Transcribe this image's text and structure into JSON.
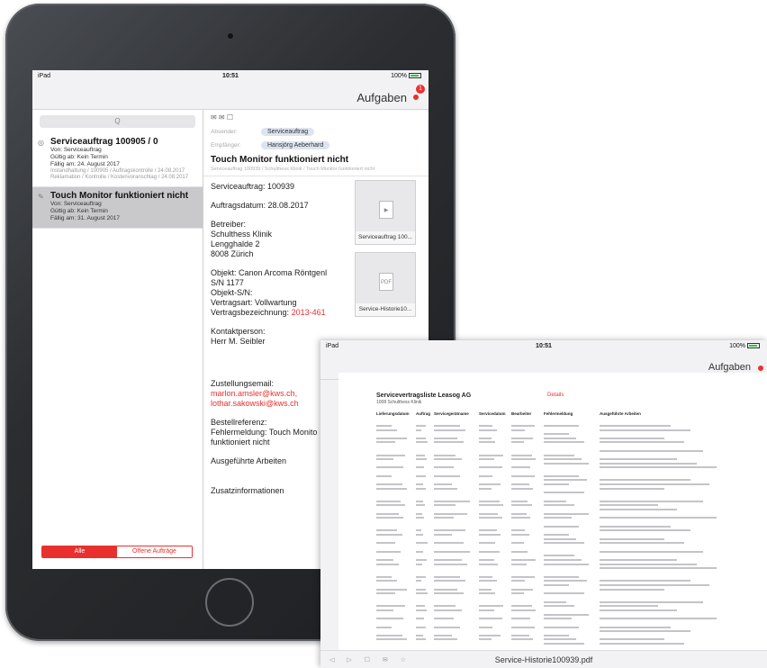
{
  "device": {
    "status": {
      "carrier": "iPad",
      "time": "10:51",
      "battery": "100%"
    },
    "nav_title": "Aufgaben",
    "badge": "1",
    "search_placeholder": "Q",
    "tasks": [
      {
        "title": "Serviceauftrag 100905 / 0",
        "from": "Von: Serviceauftrag",
        "valid": "Gültig ab: Kein Termin",
        "due": "Fällig am: 24. August 2017",
        "faint1": "Instandhaltung / 100905 / Auftragskontrolle / 24.08.2017",
        "faint2": "Reklamation / Kontrolle / Kostenvoranschlag / 24.08.2017"
      },
      {
        "title": "Touch Monitor funktioniert nicht",
        "from": "Von: Serviceauftrag",
        "valid": "Gültig ab: Kein Termin",
        "due": "Fällig am: 31. August 2017"
      }
    ],
    "segments": [
      "Alle",
      "Offene Aufträge"
    ],
    "detail": {
      "toolbar": "✉  ✉  ☐",
      "from_label": "Absender:",
      "from_value": "Serviceauftrag",
      "to_label": "Empfänger:",
      "to_value": "Hansjörg Aeberhard",
      "title": "Touch Monitor funktioniert nicht",
      "faint": "Serviceauftrag 100939 / Schulthess Klinik / Touch Monitor funktioniert nicht",
      "order": "Serviceauftrag: 100939",
      "date": "Auftragsdatum:  28.08.2017",
      "operator_label": "Betreiber:",
      "operator_name": "Schulthess Klinik",
      "operator_street": "Lengghalde 2",
      "operator_city": "8008 Zürich",
      "object": "Objekt: Canon Arcoma Röntgenl",
      "sn": "S/N 1177",
      "object_sn": "Objekt-S/N:",
      "contract_type": "Vertragsart: Vollwartung",
      "contract_label": "Vertragsbezeichnung: ",
      "contract_code": "2013-461",
      "contact_label": "Kontaktperson:",
      "contact_name": "Herr M. Seibler",
      "email_label": "Zustellungsemail:",
      "email1": "marlon.amsler@kws.ch,",
      "email2": "lothar.sakowski@kws.ch",
      "ref_label": "Bestellreferenz:",
      "ref_line1": "Fehlermeldung: Touch Monito",
      "ref_line2": "funktioniert nicht",
      "work_label": "Ausgeführte Arbeiten",
      "info_label": "Zusatzinformationen",
      "attachments": [
        {
          "caption": "Serviceauftrag 100...",
          "glyph": "▶"
        },
        {
          "caption": "Service-Historie10...",
          "glyph": "PDF"
        }
      ]
    }
  },
  "pdf_view": {
    "status": {
      "carrier": "iPad",
      "time": "10:51",
      "battery": "100%"
    },
    "nav_title": "Aufgaben",
    "heading": "Servicevertragsliste Leasog AG",
    "subheading": "1008 Schulthess Klinik",
    "link": "Details",
    "columns": [
      "Lieferungsdatum",
      "Auftrag",
      "Servicegerätname",
      "Servicedatum",
      "Bearbeiter",
      "Fehlermeldung",
      "Ausgeführte Arbeiten"
    ],
    "filename": "Service-Historie100939.pdf",
    "tools": "◁ ▷ ☐ ✉ ☆"
  }
}
